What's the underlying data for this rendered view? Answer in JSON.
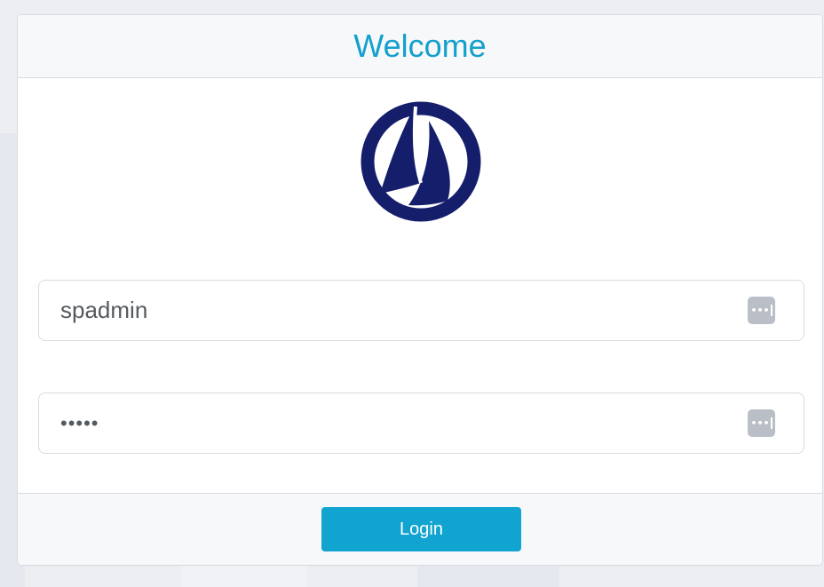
{
  "dialog": {
    "title": "Welcome"
  },
  "logo": {
    "icon": "sailboat-logo-icon",
    "color": "#141e6b"
  },
  "form": {
    "username": {
      "value": "spadmin",
      "icon": "password-manager-icon"
    },
    "password": {
      "value": "•••••",
      "icon": "password-manager-icon"
    }
  },
  "footer": {
    "login_label": "Login"
  },
  "colors": {
    "accent": "#11a4d0",
    "title": "#14a0cd",
    "logo": "#141e6b",
    "background": "#eceef2"
  }
}
